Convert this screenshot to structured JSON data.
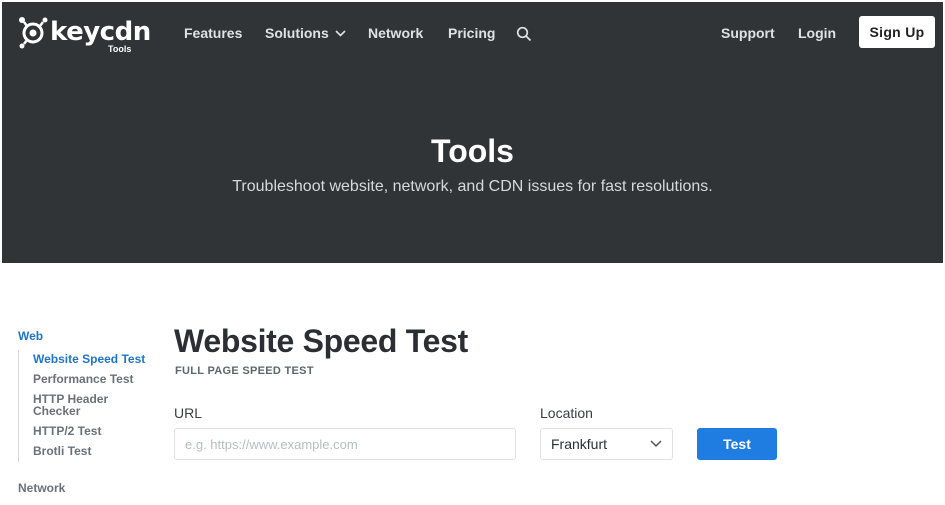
{
  "nav": {
    "brand": "keycdn",
    "brand_sub": "Tools",
    "features": "Features",
    "solutions": "Solutions",
    "network": "Network",
    "pricing": "Pricing",
    "support": "Support",
    "login": "Login",
    "signup": "Sign Up"
  },
  "hero": {
    "title": "Tools",
    "subtitle": "Troubleshoot website, network, and CDN issues for fast resolutions."
  },
  "sidebar": {
    "web_label": "Web",
    "items": [
      {
        "label": "Website Speed Test",
        "active": true
      },
      {
        "label": "Performance Test",
        "active": false
      },
      {
        "label": "HTTP Header Checker",
        "active": false
      },
      {
        "label": "HTTP/2 Test",
        "active": false
      },
      {
        "label": "Brotli Test",
        "active": false
      }
    ],
    "network_label": "Network"
  },
  "main": {
    "title": "Website Speed Test",
    "subtitle": "FULL PAGE SPEED TEST",
    "url_label": "URL",
    "url_placeholder": "e.g. https://www.example.com",
    "url_value": "",
    "location_label": "Location",
    "location_value": "Frankfurt",
    "test_button": "Test"
  },
  "colors": {
    "hero_bg": "#313437",
    "accent": "#1f7ce0",
    "link_active": "#1d76c9"
  }
}
